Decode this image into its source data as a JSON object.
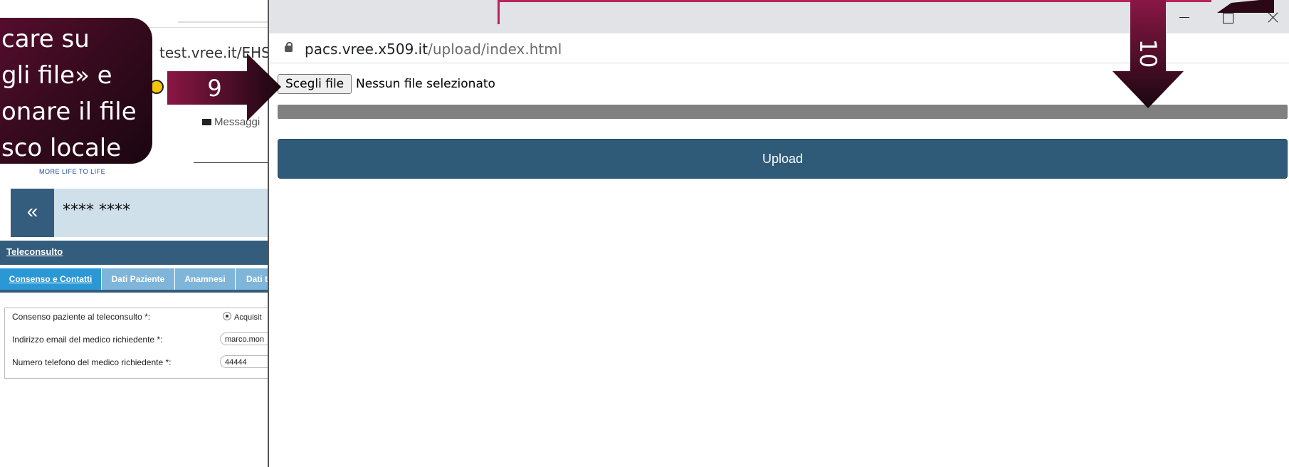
{
  "background_page": {
    "address": "test.vree.it/EHS",
    "messages_label": "Messaggi",
    "tagline": "MORE LIFE TO LIFE",
    "patient_name": "**** ****",
    "back_label": "«",
    "section_title": "Teleconsulto",
    "tabs": [
      {
        "label": "Consenso e Contatti",
        "active": true
      },
      {
        "label": "Dati Paziente",
        "active": false
      },
      {
        "label": "Anamnesi",
        "active": false
      },
      {
        "label": "Dati t",
        "active": false
      }
    ],
    "form": {
      "consent_label": "Consenso paziente al teleconsulto *:",
      "consent_value": "Acquisit",
      "email_label": "Indirizzo email del medico richiedente *:",
      "email_value": "marco.mon",
      "phone_label": "Numero telefono del medico richiedente *:",
      "phone_value": "44444"
    }
  },
  "callout": {
    "lines": [
      "care su",
      "gli file» e",
      "onare il file",
      "sco locale"
    ]
  },
  "arrows": {
    "step9": "9",
    "step10": "10"
  },
  "popup": {
    "url_host": "pacs.vree.x509.it",
    "url_path": "/upload/index.html",
    "choose_file_label": "Scegli file",
    "file_status": "Nessun file selezionato",
    "upload_label": "Upload",
    "progress": 0
  },
  "colors": {
    "callout": "#3a0b22",
    "upload_button": "#2f5a78",
    "progress_track": "#808080",
    "accent_pink": "#b8245e"
  }
}
